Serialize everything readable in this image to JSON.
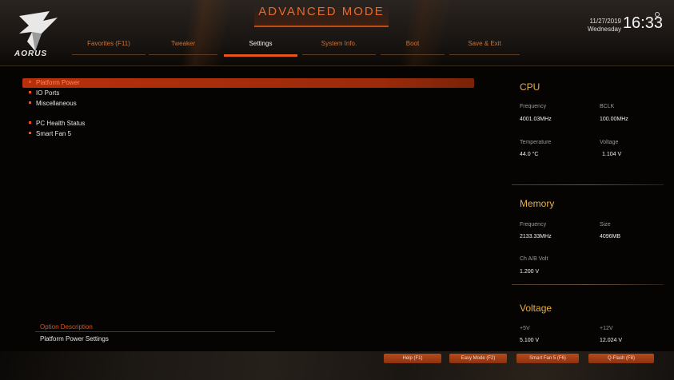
{
  "header": {
    "mode_title": "ADVANCED MODE",
    "brand": "AORUS",
    "date": "11/27/2019",
    "weekday": "Wednesday",
    "time": "16:33",
    "tabs": [
      {
        "label": "Favorites (F11)",
        "active": false
      },
      {
        "label": "Tweaker",
        "active": false
      },
      {
        "label": "Settings",
        "active": true
      },
      {
        "label": "System Info.",
        "active": false
      },
      {
        "label": "Boot",
        "active": false
      },
      {
        "label": "Save & Exit",
        "active": false
      }
    ]
  },
  "menu": {
    "items": [
      {
        "label": "Platform Power",
        "selected": true
      },
      {
        "label": "IO Ports",
        "selected": false
      },
      {
        "label": "Miscellaneous",
        "selected": false
      },
      {
        "label": "PC Health Status",
        "selected": false
      },
      {
        "label": "Smart Fan 5",
        "selected": false
      }
    ]
  },
  "description": {
    "title": "Option Description",
    "text": "Platform Power Settings"
  },
  "panel": {
    "cpu": {
      "title": "CPU",
      "frequency_label": "Frequency",
      "frequency_value": "4001.03MHz",
      "bclk_label": "BCLK",
      "bclk_value": "100.00MHz",
      "temperature_label": "Temperature",
      "temperature_value": "44.0 °C",
      "voltage_label": "Voltage",
      "voltage_value": "1.104 V"
    },
    "memory": {
      "title": "Memory",
      "frequency_label": "Frequency",
      "frequency_value": "2133.33MHz",
      "size_label": "Size",
      "size_value": "4096MB",
      "volt_label": "Ch A/B Volt",
      "volt_value": "1.200 V"
    },
    "voltage": {
      "title": "Voltage",
      "v5_label": "+5V",
      "v5_value": "5.100 V",
      "v12_label": "+12V",
      "v12_value": "12.024 V"
    }
  },
  "footer": {
    "buttons": [
      "Help (F1)",
      "Easy Mode (F2)",
      "Smart Fan 5 (F6)",
      "Q-Flash (F8)"
    ]
  },
  "colors": {
    "accent": "#e8541a",
    "panel_title": "#e8b040"
  }
}
